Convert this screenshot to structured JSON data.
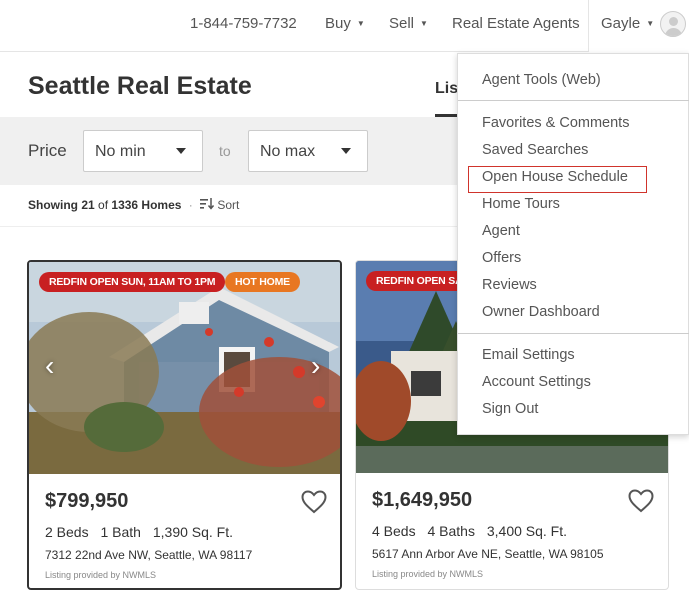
{
  "header": {
    "phone": "1-844-759-7732",
    "nav": [
      {
        "label": "Buy"
      },
      {
        "label": "Sell"
      },
      {
        "label": "Real Estate Agents"
      }
    ],
    "user_name": "Gayle"
  },
  "page": {
    "title": "Seattle Real Estate",
    "view_tab": "Lis"
  },
  "filters": {
    "price_label": "Price",
    "min_value": "No min",
    "to_label": "to",
    "max_value": "No max"
  },
  "results": {
    "showing_prefix": "Showing",
    "shown_count": "21",
    "of_word": "of",
    "total": "1336 Homes",
    "separator": "·",
    "sort_label": "Sort"
  },
  "listings": [
    {
      "tags": [
        "REDFIN OPEN SUN, 11AM TO 1PM",
        "HOT HOME"
      ],
      "price": "$799,950",
      "beds": "2 Beds",
      "baths": "1 Bath",
      "sqft": "1,390 Sq. Ft.",
      "address": "7312 22nd Ave NW, Seattle, WA 98117",
      "provider": "Listing provided by NWMLS"
    },
    {
      "tags": [
        "REDFIN OPEN SA"
      ],
      "price": "$1,649,950",
      "beds": "4 Beds",
      "baths": "4 Baths",
      "sqft": "3,400 Sq. Ft.",
      "address": "5617 Ann Arbor Ave NE, Seattle, WA 98105",
      "provider": "Listing provided by NWMLS"
    }
  ],
  "menu": {
    "items": [
      "Agent Tools (Web)",
      "Favorites & Comments",
      "Saved Searches",
      "Open House Schedule",
      "Home Tours",
      "Agent",
      "Offers",
      "Reviews",
      "Owner Dashboard",
      "Email Settings",
      "Account Settings",
      "Sign Out"
    ],
    "highlighted": "Open House Schedule"
  },
  "colors": {
    "tag_red": "#c82021",
    "tag_orange": "#e87722",
    "highlight_border": "#d0342c"
  }
}
